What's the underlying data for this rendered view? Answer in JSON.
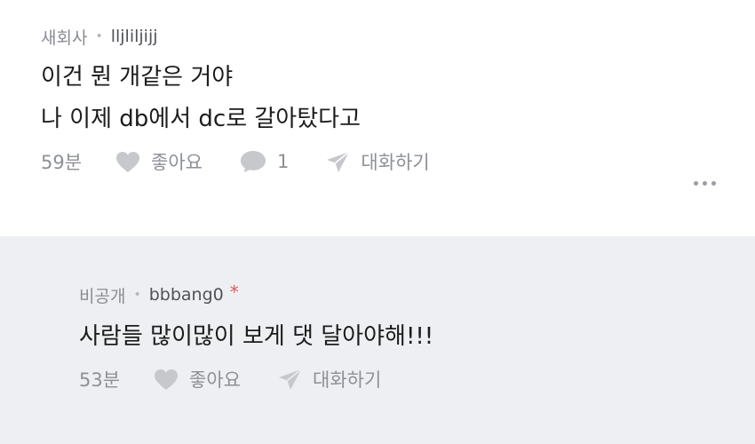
{
  "comments": [
    {
      "tag": "새회사",
      "author": "lljliljijj",
      "lines": [
        "이건 뭔 개같은 거야",
        "나 이제 db에서 dc로 갈아탔다고"
      ],
      "time": "59분",
      "like_label": "좋아요",
      "reply_count": "1",
      "chat_label": "대화하기",
      "icons": [
        "heart-icon",
        "speech-bubble-icon",
        "send-icon",
        "more-icon"
      ]
    },
    {
      "tag": "비공개",
      "author": "bbbang0",
      "author_mark": "*",
      "lines": [
        "사람들 많이많이 보게 댓 달아야해!!!"
      ],
      "time": "53분",
      "like_label": "좋아요",
      "chat_label": "대화하기",
      "icons": [
        "heart-icon",
        "send-icon"
      ]
    }
  ],
  "colors": {
    "reply_background": "#eeeff2",
    "mark": "#e05757",
    "muted_text": "#8d9096"
  }
}
